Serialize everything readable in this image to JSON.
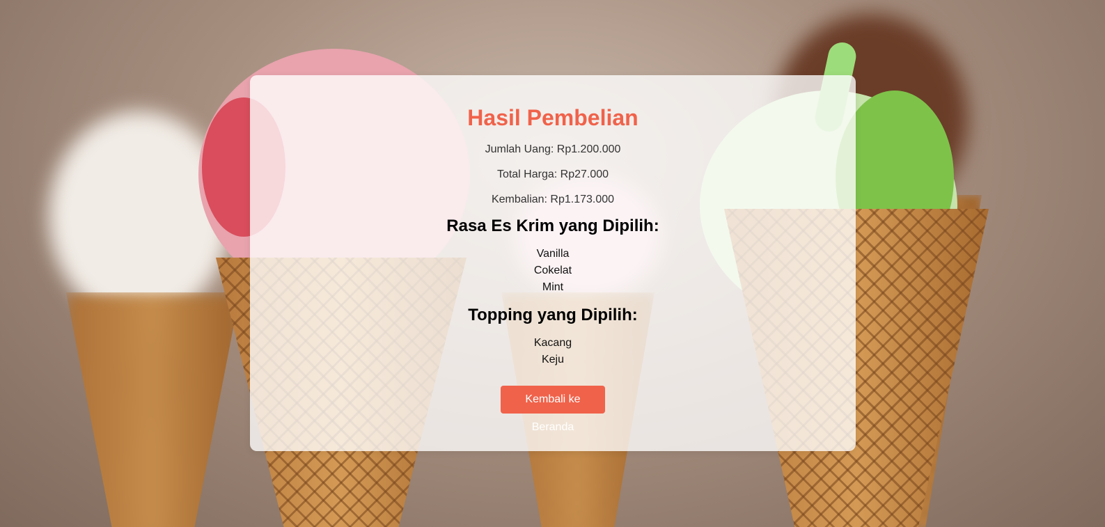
{
  "result": {
    "title": "Hasil Pembelian",
    "amount_line": "Jumlah Uang: Rp1.200.000",
    "total_line": "Total Harga: Rp27.000",
    "change_line": "Kembalian: Rp1.173.000",
    "flavors_heading": "Rasa Es Krim yang Dipilih:",
    "flavors": [
      "Vanilla",
      "Cokelat",
      "Mint"
    ],
    "toppings_heading": "Topping yang Dipilih:",
    "toppings": [
      "Kacang",
      "Keju"
    ],
    "back_button_label": "Kembali ke Beranda"
  },
  "colors": {
    "accent": "#f0624a",
    "card_background": "rgba(255,255,255,0.78)"
  }
}
